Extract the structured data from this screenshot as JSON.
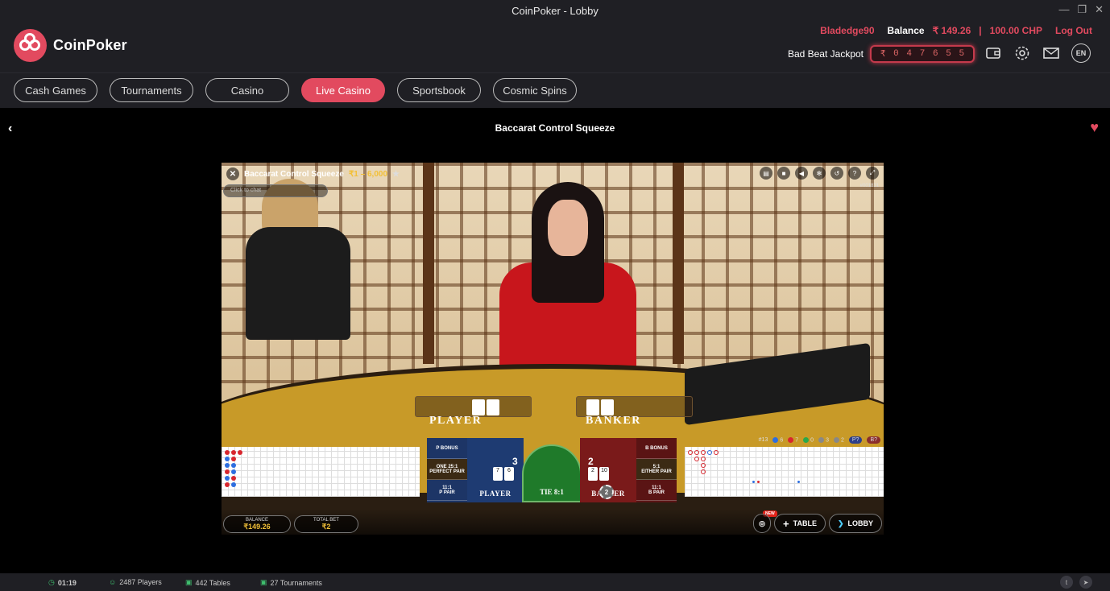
{
  "window": {
    "title": "CoinPoker - Lobby"
  },
  "brand": {
    "name": "CoinPoker",
    "accent": "#e24a5f"
  },
  "account": {
    "username": "Bladedge90",
    "balance_label": "Balance",
    "balance_inr": "₹ 149.26",
    "separator": "|",
    "balance_chp": "100.00 CHP",
    "logout": "Log Out"
  },
  "jackpot": {
    "label": "Bad Beat Jackpot",
    "digits": [
      "₹",
      "0",
      "4",
      "7",
      "6",
      "5",
      "5"
    ]
  },
  "header_icons": [
    "wallet-icon",
    "gear-icon",
    "mail-icon"
  ],
  "language": "EN",
  "nav": {
    "items": [
      {
        "label": "Cash Games",
        "active": false
      },
      {
        "label": "Tournaments",
        "active": false
      },
      {
        "label": "Casino",
        "active": false
      },
      {
        "label": "Live Casino",
        "active": true
      },
      {
        "label": "Sportsbook",
        "active": false
      },
      {
        "label": "Cosmic Spins",
        "active": false
      }
    ]
  },
  "game": {
    "title": "Baccarat Control Squeeze",
    "stream_title": "Baccarat Control Squeeze",
    "limits": "₹1 – 6,000",
    "chat_placeholder": "Click to chat",
    "game_id": "#001831",
    "felt_player": "PLAYER",
    "felt_banker": "BANKER",
    "stats": {
      "rounds": "#13",
      "p": "6",
      "b": "7",
      "t": "0",
      "pp": "3",
      "bp": "2",
      "p_label": "P?",
      "b_label": "B?"
    },
    "bet_spots": {
      "p_bonus": "P BONUS",
      "perfect_pair": "ONE 25:1 PERFECT PAIR",
      "p_pair_odds": "11:1",
      "p_pair": "P PAIR",
      "b_bonus": "B BONUS",
      "either_pair_odds": "5:1",
      "either_pair": "EITHER PAIR",
      "b_pair_odds": "11:1",
      "b_pair": "B PAIR",
      "player_label": "PLAYER",
      "player_score": "3",
      "player_cards": [
        "7",
        "6"
      ],
      "tie_label": "TIE 8:1",
      "banker_label": "BANKER",
      "banker_score": "2",
      "banker_cards": [
        "2",
        "10"
      ],
      "chip_value": "2"
    },
    "balance_label": "BALANCE",
    "balance_value": "₹149.26",
    "total_bet_label": "TOTAL BET",
    "total_bet_value": "₹2",
    "new_badge": "NEW",
    "table_btn": "TABLE",
    "lobby_btn": "LOBBY"
  },
  "status": {
    "time": "01:19",
    "players": "2487 Players",
    "tables": "442 Tables",
    "tournaments": "27 Tournaments"
  }
}
